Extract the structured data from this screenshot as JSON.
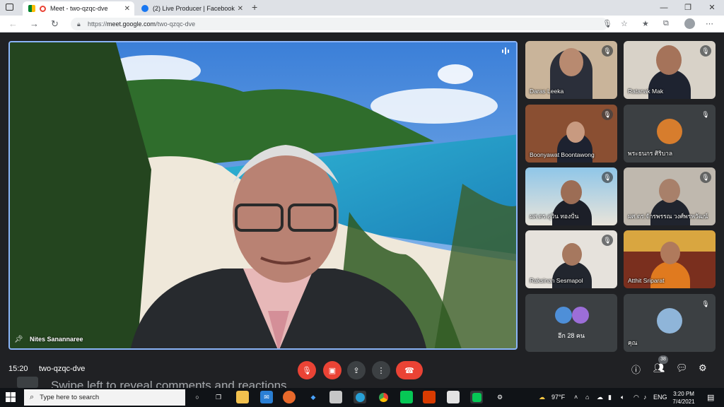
{
  "browser": {
    "tabs": [
      {
        "title": "Meet - two-qzqc-dve",
        "active": true
      },
      {
        "title": "(2) Live Producer | Facebook",
        "active": false
      }
    ],
    "url_prefix": "https://",
    "url_host": "meet.google.com",
    "url_path": "/two-qzqc-dve"
  },
  "meeting": {
    "main_speaker": "Nites Sanannaree",
    "participants": [
      {
        "name": "Daras Leeka",
        "muted": true
      },
      {
        "name": "Ratanak Mak",
        "muted": true
      },
      {
        "name": "Boonyawat Boontawong",
        "muted": true
      },
      {
        "name": "พระธนกร ศิริบาล",
        "muted": true
      },
      {
        "name": "ผศ.ดร.สุวิน ทองปั่น",
        "muted": true
      },
      {
        "name": "ผศ.ดร.จักรพรรณ วงศ์พรพวัฒน์",
        "muted": true
      },
      {
        "name": "Raksinan Sesmapol",
        "muted": true
      },
      {
        "name": "Atthit Sriparat",
        "muted": false
      },
      {
        "name": "อีก 28 คน",
        "muted": false
      },
      {
        "name": "คุณ",
        "muted": true
      }
    ],
    "time": "15:20",
    "code": "two-qzqc-dve",
    "participant_count": "38",
    "swipe_hint": "Swipe left to reveal comments and reactions"
  },
  "taskbar": {
    "search_placeholder": "Type here to search",
    "weather": "97°F",
    "lang": "ENG",
    "time": "3:20 PM",
    "date": "7/4/2021"
  },
  "colors": {
    "meet_bg": "#202124",
    "end_call": "#ea4335",
    "speaking_border": "#8ab4f8"
  }
}
